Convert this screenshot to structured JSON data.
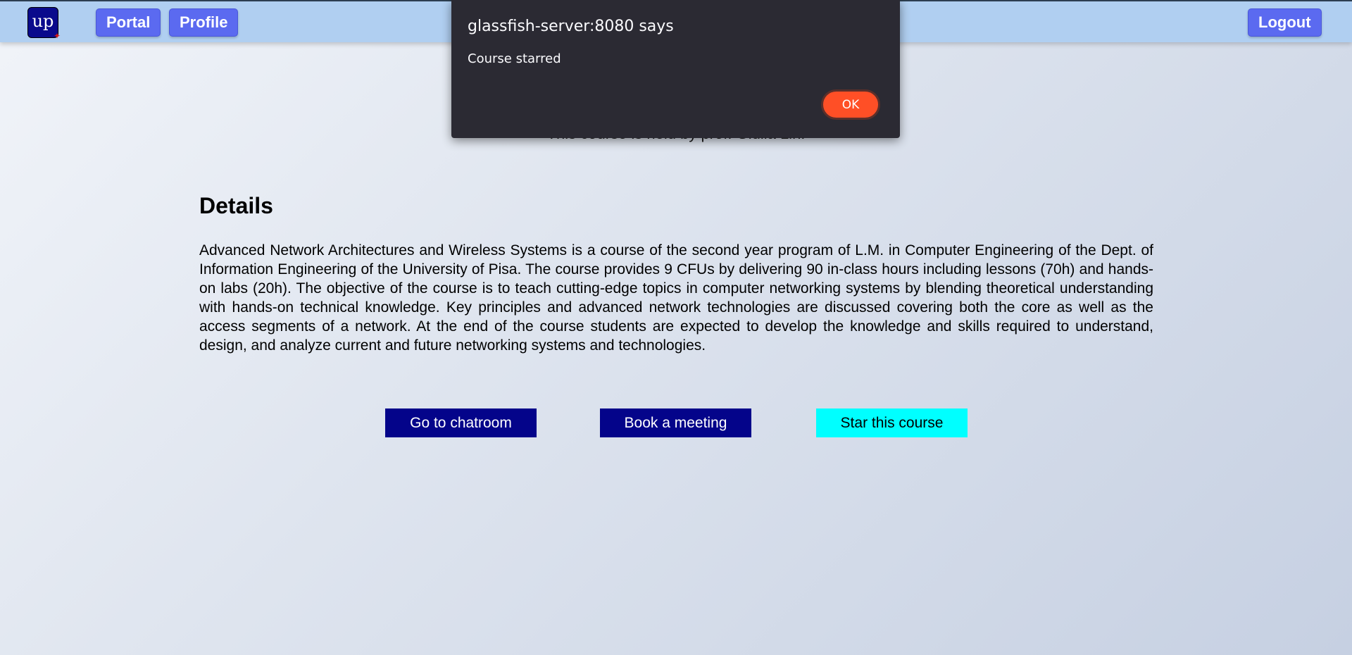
{
  "header": {
    "logo_text": "up",
    "nav": [
      {
        "label": "Portal"
      },
      {
        "label": "Profile"
      }
    ],
    "logout_label": "Logout"
  },
  "course": {
    "subtitle": "This course is held by prof. Giulia Lin."
  },
  "details": {
    "heading": "Details",
    "text": "Advanced Network Architectures and Wireless Systems is a course of the second year program of L.M. in Computer Engineering of the Dept. of Information Engineering of the University of Pisa. The course provides 9 CFUs by delivering 90 in-class hours including lessons (70h) and hands-on labs (20h). The objective of the course is to teach cutting-edge topics in computer networking systems by blending theoretical understanding with hands-on technical knowledge. Key principles and advanced network technologies are discussed covering both the core as well as the access segments of a network. At the end of the course students are expected to develop the knowledge and skills required to understand, design, and analyze current and future networking systems and technologies."
  },
  "actions": {
    "chatroom": "Go to chatroom",
    "meeting": "Book a meeting",
    "star": "Star this course"
  },
  "dialog": {
    "title": "glassfish-server:8080 says",
    "message": "Course starred",
    "ok_label": "OK"
  },
  "colors": {
    "topbar": "#b0cff1",
    "nav_button": "#5b6af0",
    "action_dark": "#04048a",
    "action_cyan": "#00ffff",
    "dialog_bg": "#2b2a33",
    "dialog_ok": "#ff4f26"
  }
}
